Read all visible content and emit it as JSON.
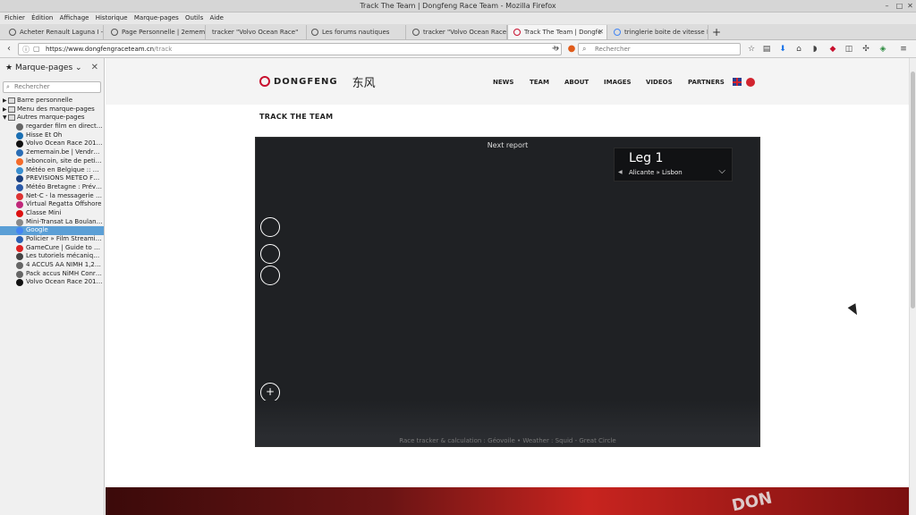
{
  "window": {
    "title": "Track The Team | Dongfeng Race Team - Mozilla Firefox"
  },
  "menu": [
    "Fichier",
    "Édition",
    "Affichage",
    "Historique",
    "Marque-pages",
    "Outils",
    "Aide"
  ],
  "tabs": [
    {
      "label": "Acheter Renault Laguna I - l"
    },
    {
      "label": "Page Personnelle | 2emem"
    },
    {
      "label": "tracker \"Volvo Ocean Race\""
    },
    {
      "label": "Les forums nautiques"
    },
    {
      "label": "tracker \"Volvo Ocean Race\""
    },
    {
      "label": "Track The Team | Dongfe"
    },
    {
      "label": "tringlerie boite de vitesse Ft"
    }
  ],
  "nav": {
    "url_host": "https://www.dongfengraceteam.cn",
    "url_path": "/track",
    "search_placeholder": "Rechercher"
  },
  "sidebar": {
    "title": "Marque-pages",
    "search_placeholder": "Rechercher",
    "folders": [
      "Barre personnelle",
      "Menu des marque-pages",
      "Autres marque-pages"
    ],
    "bookmarks": [
      {
        "label": "regarder film en direct, str...",
        "color": "#666666"
      },
      {
        "label": "Hisse Et Oh",
        "color": "#1a6fb3"
      },
      {
        "label": "Volvo Ocean Race 2017-18",
        "color": "#111111"
      },
      {
        "label": "2ememain.be | Vendre et ...",
        "color": "#2a6db5"
      },
      {
        "label": "leboncoin, site de petites a...",
        "color": "#f56b2a"
      },
      {
        "label": "Météo en Belgique :: Nos p...",
        "color": "#3a8fd0"
      },
      {
        "label": "PREVISIONS METEO FRAN...",
        "color": "#1a3f80"
      },
      {
        "label": "Météo Bretagne : Prévisio...",
        "color": "#2b5aa8"
      },
      {
        "label": "Net-C - la messagerie eur...",
        "color": "#d33"
      },
      {
        "label": "Virtual Regatta Offshore",
        "color": "#c0287a"
      },
      {
        "label": "Classe Mini",
        "color": "#d11"
      },
      {
        "label": "Mini-Transat La Boulangèr...",
        "color": "#888888"
      },
      {
        "label": "Google",
        "color": "#4285f4"
      },
      {
        "label": "Policier » Film Streaming |...",
        "color": "#2a60b0"
      },
      {
        "label": "GameCure | Guide to Root...",
        "color": "#d22"
      },
      {
        "label": "Les tutoriels mécanique p...",
        "color": "#444444"
      },
      {
        "label": "4 ACCUS AA NIMH 1,2V 25...",
        "color": "#666666"
      },
      {
        "label": "Pack accus NiMH Conrad ...",
        "color": "#666666"
      },
      {
        "label": "Volvo Ocean Race 2017 - 2...",
        "color": "#111111"
      }
    ]
  },
  "site": {
    "logo_text": "DONGFENG",
    "logo_cn": "东风",
    "nav": [
      "NEWS",
      "TEAM",
      "ABOUT",
      "IMAGES",
      "VIDEOS",
      "PARTNERS"
    ],
    "section_title": "TRACK THE TEAM"
  },
  "tracker": {
    "next_report": "Next report",
    "leg_title": "Leg 1",
    "leg_route": "Alicante » Lisbon",
    "zoom_in": "+",
    "zoom_out": "−",
    "footer": "Race tracker & calculation : Géovoile • Weather : Squid - Great Circle"
  },
  "hero": {
    "brand_text": "DON"
  }
}
